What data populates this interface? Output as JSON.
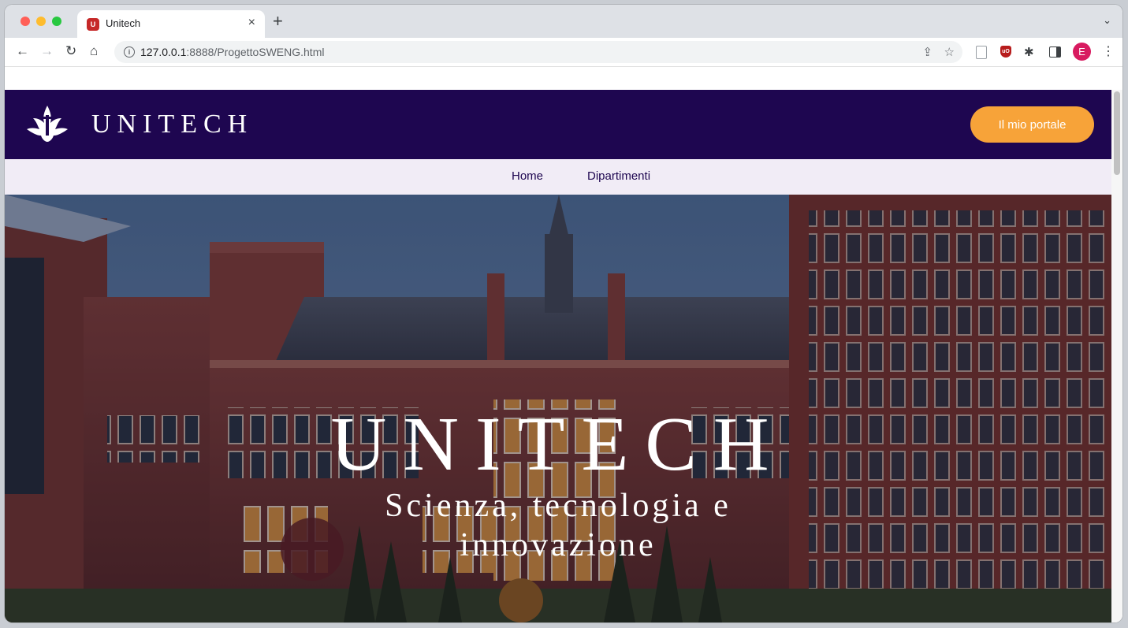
{
  "browser": {
    "tab": {
      "title": "Unitech",
      "favicon": "unitech-favicon",
      "close_label": "×"
    },
    "new_tab_label": "+",
    "tab_menu_label": "⌄",
    "url": {
      "host": "127.0.0.1",
      "path": ":8888/ProgettoSWENG.html"
    },
    "profile_initial": "E"
  },
  "site": {
    "brand": "UNITECH",
    "portal_button": "Il mio portale",
    "nav": [
      {
        "label": "Home"
      },
      {
        "label": "Dipartimenti"
      }
    ],
    "hero": {
      "title": "UNITECH",
      "subtitle": "Scienza, tecnologia e innovazione"
    }
  },
  "colors": {
    "header_bg": "#1e0650",
    "nav_bg": "#f1ecf6",
    "accent": "#f7a339"
  }
}
